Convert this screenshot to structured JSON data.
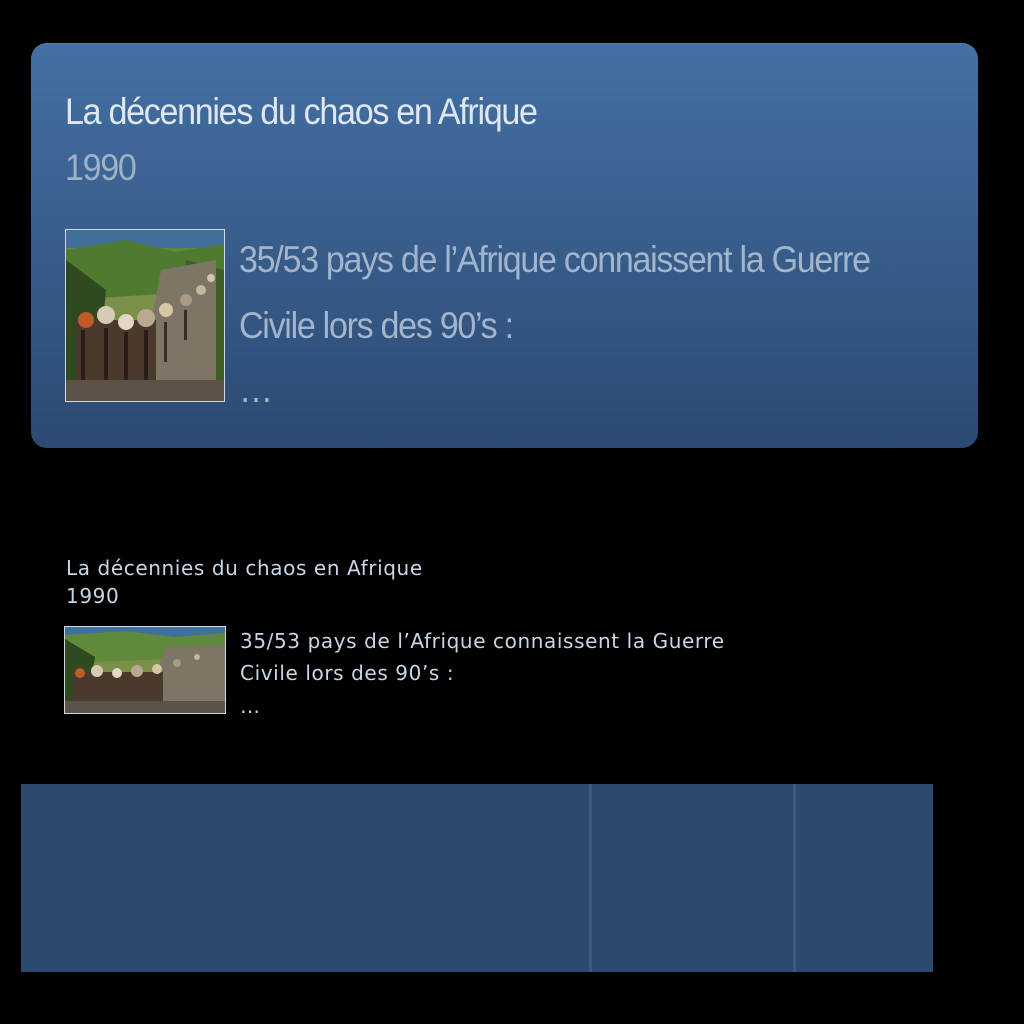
{
  "card": {
    "title": "La décennies du chaos en Afrique",
    "year": "1990",
    "lines": [
      "35/53 pays de l’Afrique connaissent la Guerre",
      "Civile lors des 90’s :",
      "…"
    ]
  },
  "preview": {
    "title": "La décennies du chaos en Afrique",
    "year": "1990",
    "lines": [
      "35/53 pays de l’Afrique connaissent la Guerre",
      "Civile lors des 90’s :",
      "…"
    ]
  },
  "colors": {
    "card_top": "#4470a3",
    "card_bottom": "#2c4a72",
    "panel": "#2c4a6f",
    "background": "#000000"
  },
  "icons": {
    "card_thumbnail": "refugee-road-photo",
    "preview_thumbnail": "refugee-road-photo"
  }
}
